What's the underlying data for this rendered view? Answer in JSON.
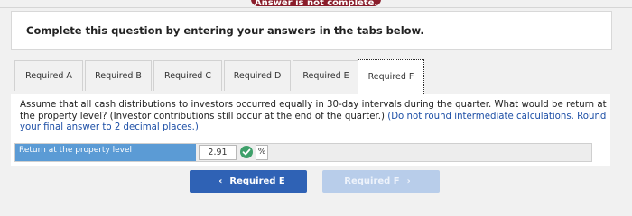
{
  "header": {
    "badge_text": "Answer is not complete."
  },
  "instructions": "Complete this question by entering your answers in the tabs below.",
  "tabs": [
    {
      "label": "Required A",
      "active": false
    },
    {
      "label": "Required B",
      "active": false
    },
    {
      "label": "Required C",
      "active": false
    },
    {
      "label": "Required D",
      "active": false
    },
    {
      "label": "Required E",
      "active": false
    },
    {
      "label": "Required F",
      "active": true
    }
  ],
  "question": {
    "text": "Assume that all cash distributions to investors occurred equally in 30-day intervals during the quarter. What would be return at the property level? (Investor contributions still occur at the end of the quarter.)",
    "hint": "(Do not round intermediate calculations. Round your final answer to 2 decimal places.)"
  },
  "answer": {
    "label": "Return at the property level",
    "value": "2.91",
    "unit": "%",
    "status_icon": "check-circle-icon"
  },
  "nav": {
    "prev_label": "Required E",
    "next_label": "Required F",
    "prev_chevron": "‹",
    "next_chevron": "›"
  },
  "colors": {
    "accent": "#2f62b5",
    "label_bg": "#5b9bd5",
    "correct": "#3ea06a",
    "hint": "#1d4fa6",
    "badge": "#8a1d2b"
  }
}
